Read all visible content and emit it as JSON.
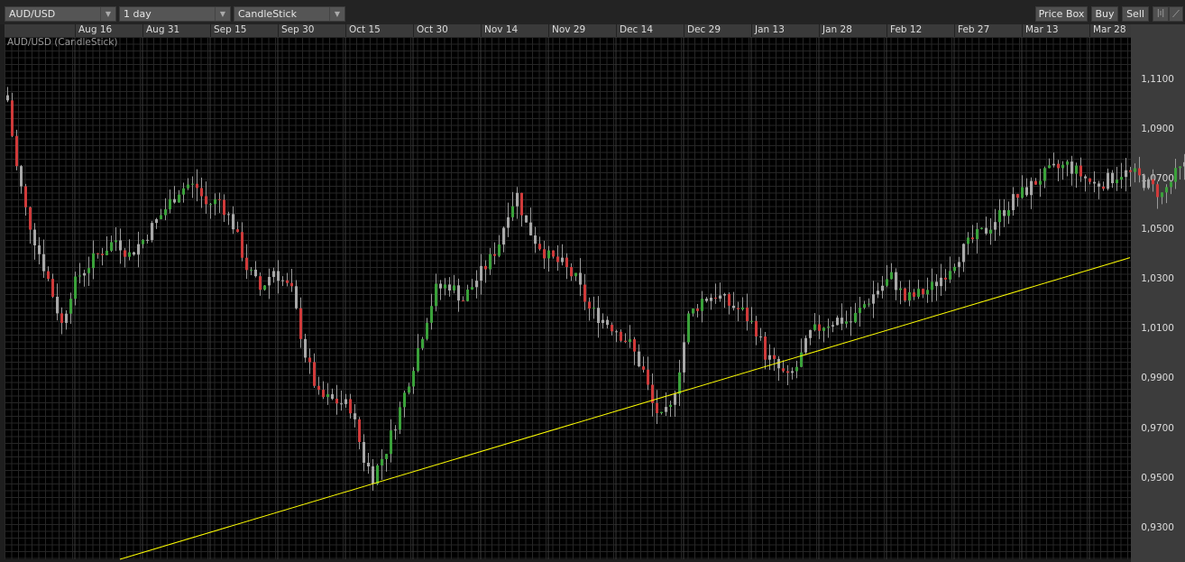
{
  "toolbar": {
    "symbol": "AUD/USD",
    "interval": "1 day",
    "chart_type": "CandleStick",
    "price_box": "Price Box",
    "buy": "Buy",
    "sell": "Sell"
  },
  "chart_data": {
    "type": "candlestick",
    "title": "AUD/USD (CandleStick)",
    "x_ticks": [
      "Aug 16",
      "Aug 31",
      "Sep 15",
      "Sep 30",
      "Oct 15",
      "Oct 30",
      "Nov 14",
      "Nov 29",
      "Dec 14",
      "Dec 29",
      "Jan 13",
      "Jan 28",
      "Feb 12",
      "Feb 27",
      "Mar 13",
      "Mar 28"
    ],
    "y_ticks": [
      "1,1100",
      "1,0900",
      "1,0700",
      "1,0500",
      "1,0300",
      "1,0100",
      "0,9900",
      "0,9700",
      "0,9500",
      "0,9300"
    ],
    "y_tick_values": [
      1.11,
      1.09,
      1.07,
      1.05,
      1.03,
      1.01,
      0.99,
      0.97,
      0.95,
      0.93
    ],
    "ylim": [
      0.9177,
      1.1274
    ],
    "days_per_tick": 15,
    "first_tick_day": 15,
    "close_path": [
      [
        0,
        1.102
      ],
      [
        1,
        1.088
      ],
      [
        2,
        1.075
      ],
      [
        4,
        1.058
      ],
      [
        6,
        1.046
      ],
      [
        9,
        1.03
      ],
      [
        12,
        1.012
      ],
      [
        14,
        1.025
      ],
      [
        16,
        1.032
      ],
      [
        20,
        1.04
      ],
      [
        24,
        1.046
      ],
      [
        27,
        1.04
      ],
      [
        30,
        1.046
      ],
      [
        34,
        1.056
      ],
      [
        38,
        1.066
      ],
      [
        40,
        1.068
      ],
      [
        42,
        1.067
      ],
      [
        44,
        1.06
      ],
      [
        47,
        1.062
      ],
      [
        50,
        1.052
      ],
      [
        53,
        1.035
      ],
      [
        56,
        1.026
      ],
      [
        59,
        1.034
      ],
      [
        63,
        1.025
      ],
      [
        66,
        1.0
      ],
      [
        69,
        0.983
      ],
      [
        73,
        0.981
      ],
      [
        76,
        0.979
      ],
      [
        79,
        0.958
      ],
      [
        81,
        0.951
      ],
      [
        84,
        0.962
      ],
      [
        87,
        0.978
      ],
      [
        90,
        0.996
      ],
      [
        93,
        1.015
      ],
      [
        95,
        1.026
      ],
      [
        98,
        1.028
      ],
      [
        101,
        1.022
      ],
      [
        104,
        1.03
      ],
      [
        107,
        1.038
      ],
      [
        109,
        1.045
      ],
      [
        111,
        1.058
      ],
      [
        113,
        1.064
      ],
      [
        115,
        1.052
      ],
      [
        117,
        1.046
      ],
      [
        120,
        1.039
      ],
      [
        123,
        1.036
      ],
      [
        126,
        1.03
      ],
      [
        129,
        1.018
      ],
      [
        132,
        1.014
      ],
      [
        135,
        1.01
      ],
      [
        138,
        1.004
      ],
      [
        141,
        0.993
      ],
      [
        143,
        0.98
      ],
      [
        145,
        0.974
      ],
      [
        147,
        0.978
      ],
      [
        149,
        0.995
      ],
      [
        151,
        1.015
      ],
      [
        154,
        1.022
      ],
      [
        157,
        1.024
      ],
      [
        160,
        1.02
      ],
      [
        163,
        1.017
      ],
      [
        166,
        1.01
      ],
      [
        168,
        1.0
      ],
      [
        171,
        0.994
      ],
      [
        173,
        0.99
      ],
      [
        175,
        0.995
      ],
      [
        178,
        1.008
      ],
      [
        181,
        1.012
      ],
      [
        184,
        1.014
      ],
      [
        187,
        1.013
      ],
      [
        190,
        1.02
      ],
      [
        193,
        1.026
      ],
      [
        196,
        1.031
      ],
      [
        199,
        1.022
      ],
      [
        202,
        1.024
      ],
      [
        205,
        1.027
      ],
      [
        208,
        1.033
      ],
      [
        211,
        1.04
      ],
      [
        214,
        1.046
      ],
      [
        217,
        1.05
      ],
      [
        220,
        1.056
      ],
      [
        223,
        1.062
      ],
      [
        226,
        1.066
      ],
      [
        229,
        1.071
      ],
      [
        232,
        1.074
      ],
      [
        235,
        1.076
      ],
      [
        238,
        1.072
      ],
      [
        241,
        1.068
      ],
      [
        244,
        1.07
      ],
      [
        247,
        1.073
      ],
      [
        250,
        1.072
      ],
      [
        253,
        1.068
      ],
      [
        256,
        1.064
      ],
      [
        259,
        1.072
      ],
      [
        262,
        1.077
      ],
      [
        265,
        1.073
      ],
      [
        268,
        1.064
      ],
      [
        271,
        1.058
      ],
      [
        274,
        1.054
      ],
      [
        277,
        1.052
      ],
      [
        280,
        1.055
      ],
      [
        283,
        1.057
      ],
      [
        286,
        1.053
      ],
      [
        288,
        1.044
      ],
      [
        290,
        1.04
      ],
      [
        292,
        1.046
      ],
      [
        294,
        1.049
      ],
      [
        296,
        1.042
      ],
      [
        298,
        1.036
      ],
      [
        299,
        1.035
      ]
    ],
    "trendline": {
      "start": [
        25,
        0.9177
      ],
      "end": [
        249,
        1.0388
      ],
      "color": "#ffff00"
    },
    "colors": {
      "up": "#3aa23a",
      "down": "#d03a3a",
      "neutral": "#a8a8a8"
    }
  }
}
